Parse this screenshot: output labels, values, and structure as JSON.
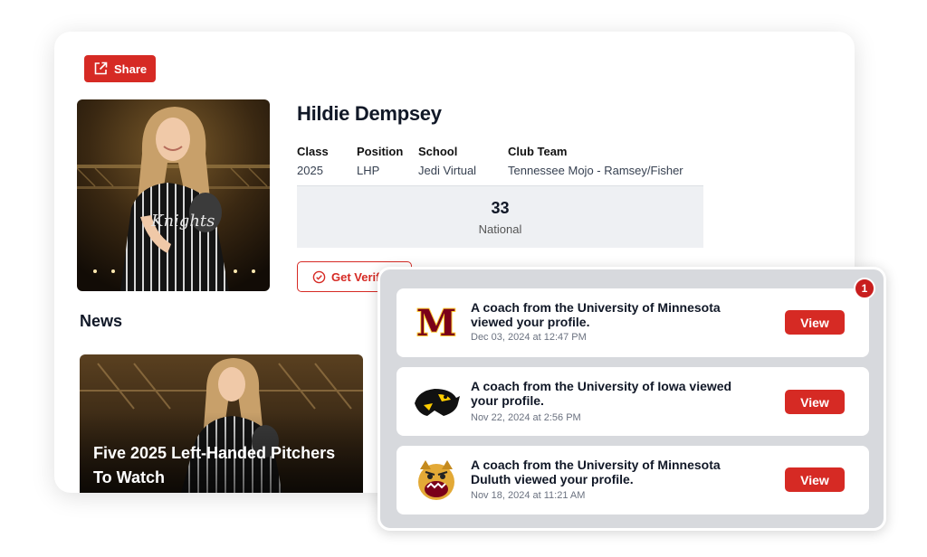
{
  "profile": {
    "share_label": "Share",
    "name": "Hildie Dempsey",
    "fields": [
      {
        "label": "Class",
        "value": "2025"
      },
      {
        "label": "Position",
        "value": "LHP"
      },
      {
        "label": "School",
        "value": "Jedi Virtual"
      },
      {
        "label": "Club Team",
        "value": "Tennessee Mojo - Ramsey/Fisher"
      }
    ],
    "rank": {
      "value": "33",
      "label": "National"
    },
    "verify_label": "Get Verified",
    "photo_jersey_text": "Knights"
  },
  "news": {
    "heading": "News",
    "items": [
      {
        "title": "Five 2025 Left-Handed Pitchers To Watch"
      }
    ]
  },
  "notifications": {
    "badge_count": "1",
    "items": [
      {
        "message": "A coach from the University of Minnesota viewed your profile.",
        "timestamp": "Dec 03, 2024 at 12:47 PM",
        "button": "View",
        "logo_icon": "minnesota-m-logo",
        "logo_text": "M"
      },
      {
        "message": "A coach from the University of Iowa viewed your profile.",
        "timestamp": "Nov 22, 2024 at 2:56 PM",
        "button": "View",
        "logo_icon": "iowa-hawkeye-logo"
      },
      {
        "message": "A coach from the University of Minnesota Duluth viewed your profile.",
        "timestamp": "Nov 18, 2024 at 11:21 AM",
        "button": "View",
        "logo_icon": "bulldog-logo"
      }
    ]
  },
  "colors": {
    "accent": "#d62a24",
    "maroon": "#7a0019",
    "gold": "#ffcc33"
  }
}
